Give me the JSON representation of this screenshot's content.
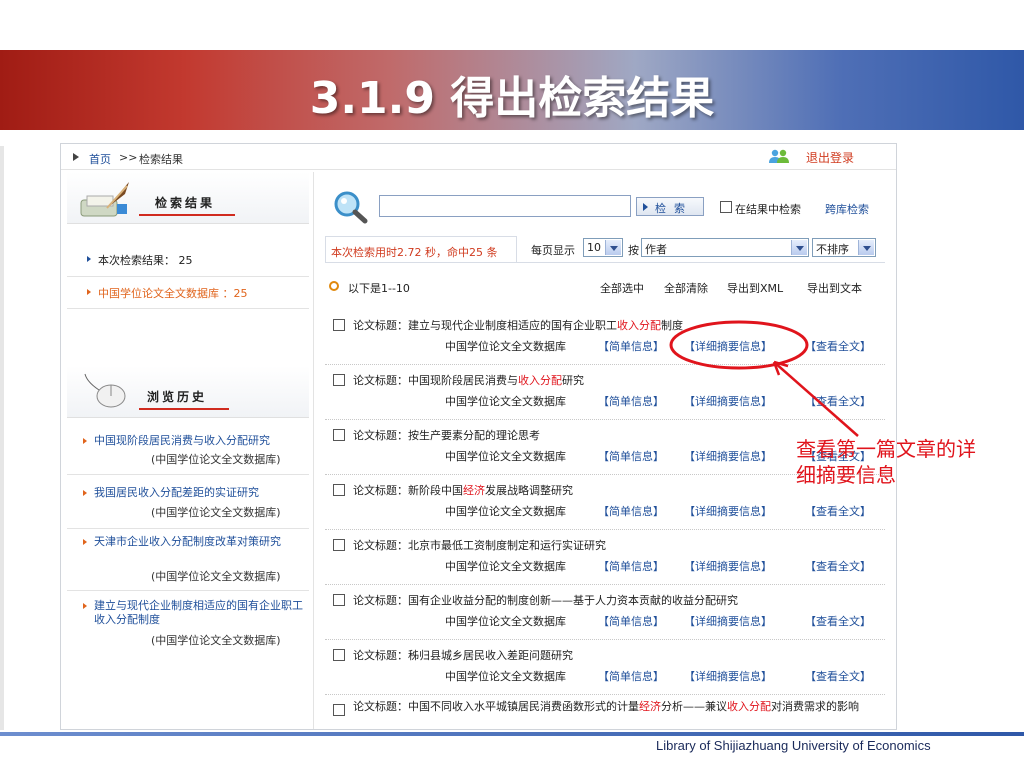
{
  "slide": {
    "title": "3.1.9 得出检索结果",
    "footer": "Library of Shijiazhuang University of Economics"
  },
  "colors": {
    "accent_red": "#d03b1f",
    "link_blue": "#1f4f9a",
    "highlight": "#e0141c"
  },
  "breadcrumb": {
    "home": "首页",
    "sep": ">>",
    "current": "检索结果",
    "logout": "退出登录"
  },
  "left": {
    "results_header": "检索结果",
    "count_label": "本次检索结果：",
    "count_value": "25",
    "db_item": "中国学位论文全文数据库 ：25",
    "history_header": "浏览历史",
    "history": [
      {
        "title": "中国现阶段居民消费与收入分配研究",
        "db": "(中国学位论文全文数据库)"
      },
      {
        "title": "我国居民收入分配差距的实证研究",
        "db": "(中国学位论文全文数据库)"
      },
      {
        "title": "天津市企业收入分配制度改革对策研究",
        "db": "(中国学位论文全文数据库)"
      },
      {
        "title": "建立与现代企业制度相适应的国有企业职工收入分配制度",
        "db": "(中国学位论文全文数据库)"
      }
    ]
  },
  "search": {
    "button": "检索",
    "in_results": "在结果中检索",
    "cross_db": "跨库检索",
    "stats": "本次检索用时2.72 秒，命中25 条",
    "per_page_label": "每页显示",
    "per_page_value": "10",
    "sort_by_label": "按",
    "sort_field": "作者",
    "sort_order": "不排序"
  },
  "toolbar": {
    "range": "以下是1--10",
    "select_all": "全部选中",
    "clear_all": "全部清除",
    "export_xml": "导出到XML",
    "export_text": "导出到文本"
  },
  "record_labels": {
    "prefix": "论文标题：",
    "db": "中国学位论文全文数据库",
    "simple": "【简单信息】",
    "detail": "【详细摘要信息】",
    "fulltext": "【查看全文】"
  },
  "records": [
    {
      "pre": "建立与现代企业制度相适应的国有企业职工",
      "hl": "收入分配",
      "post": "制度"
    },
    {
      "pre": "中国现阶段居民消费与",
      "hl": "收入分配",
      "post": "研究"
    },
    {
      "pre": "按生产要素分配的理论思考",
      "hl": "",
      "post": ""
    },
    {
      "pre": "新阶段中国",
      "hl": "经济",
      "post": "发展战略调整研究"
    },
    {
      "pre": "北京市最低工资制度制定和运行实证研究",
      "hl": "",
      "post": ""
    },
    {
      "pre": "国有企业收益分配的制度创新——基于人力资本贡献的收益分配研究",
      "hl": "",
      "post": ""
    },
    {
      "pre": "秭归县城乡居民收入差距问题研究",
      "hl": "",
      "post": ""
    },
    {
      "pre": "中国不同收入水平城镇居民消费函数形式的计量",
      "hl": "经济",
      "post": "分析——兼议",
      "hl2": "收入分配",
      "post2": "对消费需求的影响"
    }
  ],
  "annotation": {
    "text": "查看第一篇文章的详细摘要信息"
  }
}
